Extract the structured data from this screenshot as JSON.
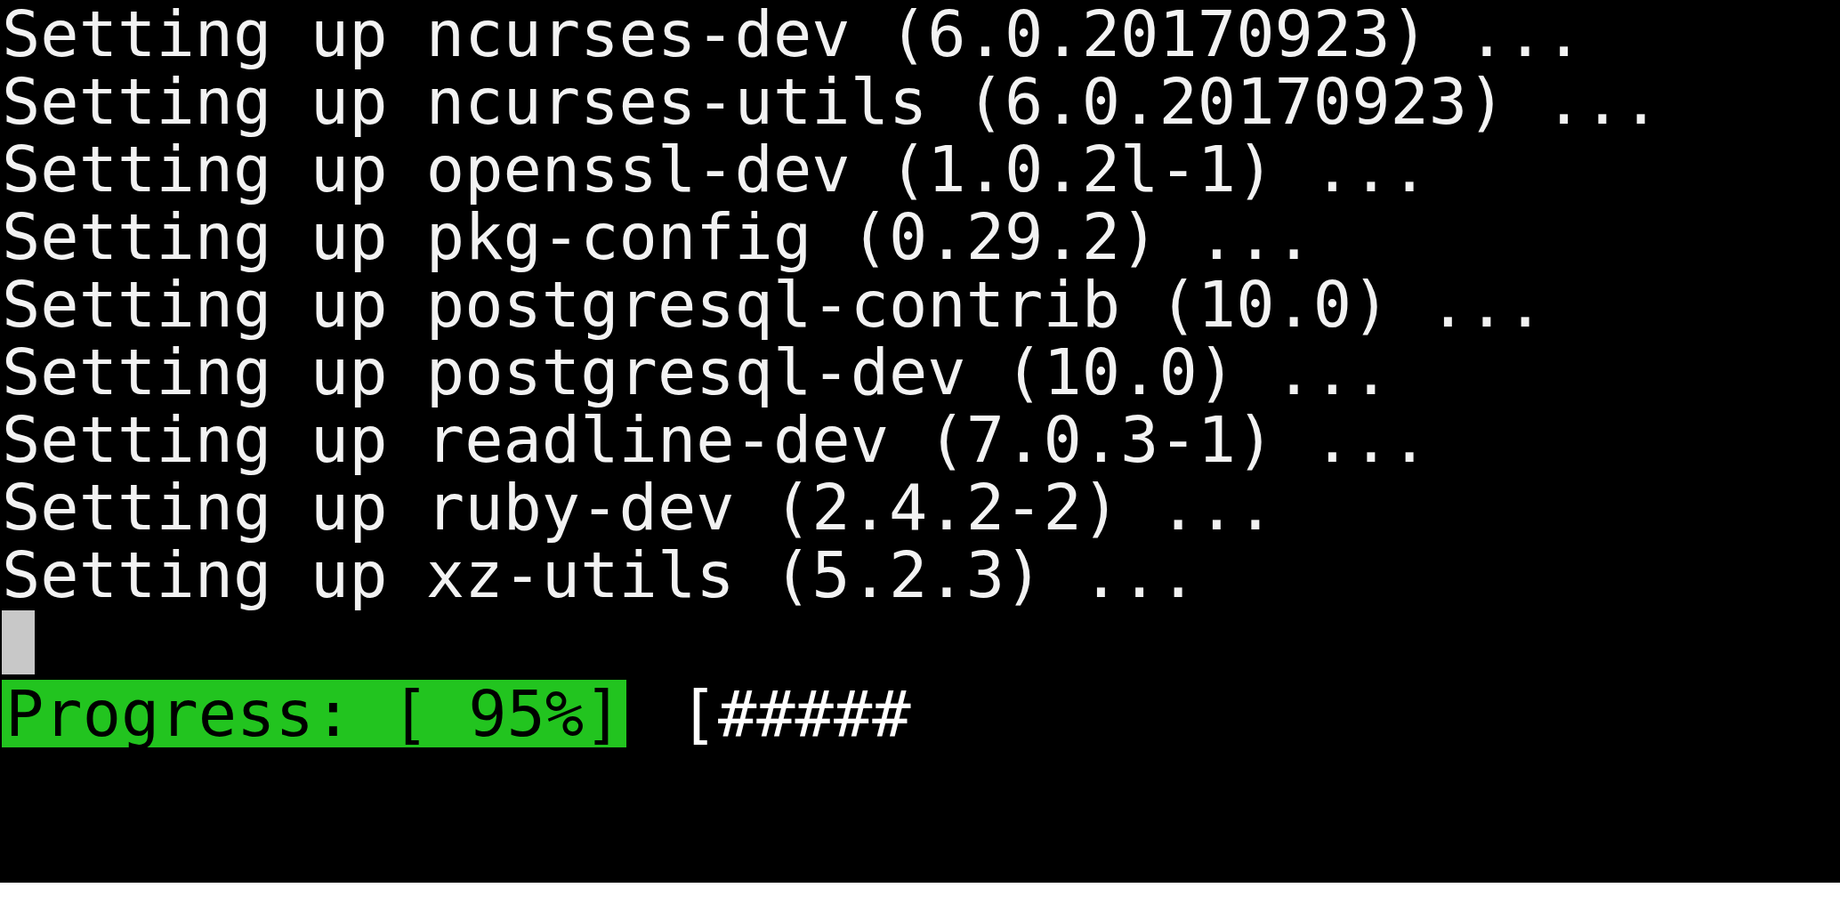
{
  "terminal": {
    "lines": [
      "Setting up ncurses-dev (6.0.20170923) ...",
      "Setting up ncurses-utils (6.0.20170923) ...",
      "Setting up openssl-dev (1.0.2l-1) ...",
      "Setting up pkg-config (0.29.2) ...",
      "Setting up postgresql-contrib (10.0) ...",
      "Setting up postgresql-dev (10.0) ...",
      "Setting up readline-dev (7.0.3-1) ...",
      "Setting up ruby-dev (2.4.2-2) ...",
      "Setting up xz-utils (5.2.3) ..."
    ],
    "progress": {
      "label": "Progress: [ 95%]",
      "bar": "[#####"
    }
  }
}
